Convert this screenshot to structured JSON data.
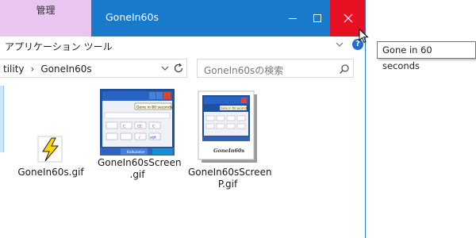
{
  "titlebar": {
    "context_tab": "管理",
    "title": "GoneIn60s",
    "controls": {
      "minimize": "minimize-icon",
      "maximize": "maximize-icon",
      "close": "close-icon"
    }
  },
  "ribbon": {
    "label": "アプリケーション ツール"
  },
  "address": {
    "crumbs": [
      "tility",
      "GoneIn60s"
    ]
  },
  "search": {
    "placeholder": "GoneIn60sの検索"
  },
  "files": [
    {
      "name_line1": "GoneIn60s.gif",
      "name_line2": ""
    },
    {
      "name_line1": "GoneIn60sScreen",
      "name_line2": ".gif"
    },
    {
      "name_line1": "GoneIn60sScreen",
      "name_line2": "P.gif"
    }
  ],
  "thumbs": {
    "tooltip": "Gone in 60 seconds",
    "taskbar_app": "Kalkulator",
    "card_label": "GoneIn60s",
    "calc_keys": [
      "C",
      "CE",
      "C",
      "/",
      "sqrt"
    ]
  },
  "tooltip": {
    "text": "Gone in 60 seconds"
  },
  "colors": {
    "titlebar": "#1979ca",
    "close": "#e81123",
    "context_tab": "#e8c6f0"
  }
}
